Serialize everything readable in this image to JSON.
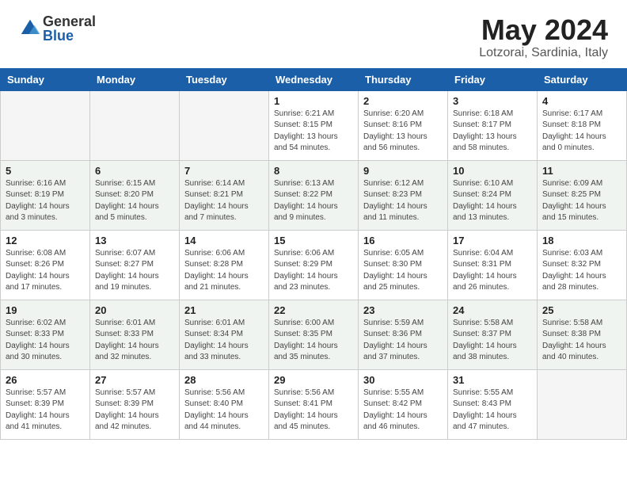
{
  "header": {
    "logo_general": "General",
    "logo_blue": "Blue",
    "month_title": "May 2024",
    "location": "Lotzorai, Sardinia, Italy"
  },
  "weekdays": [
    "Sunday",
    "Monday",
    "Tuesday",
    "Wednesday",
    "Thursday",
    "Friday",
    "Saturday"
  ],
  "weeks": [
    [
      {
        "day": "",
        "info": ""
      },
      {
        "day": "",
        "info": ""
      },
      {
        "day": "",
        "info": ""
      },
      {
        "day": "1",
        "info": "Sunrise: 6:21 AM\nSunset: 8:15 PM\nDaylight: 13 hours\nand 54 minutes."
      },
      {
        "day": "2",
        "info": "Sunrise: 6:20 AM\nSunset: 8:16 PM\nDaylight: 13 hours\nand 56 minutes."
      },
      {
        "day": "3",
        "info": "Sunrise: 6:18 AM\nSunset: 8:17 PM\nDaylight: 13 hours\nand 58 minutes."
      },
      {
        "day": "4",
        "info": "Sunrise: 6:17 AM\nSunset: 8:18 PM\nDaylight: 14 hours\nand 0 minutes."
      }
    ],
    [
      {
        "day": "5",
        "info": "Sunrise: 6:16 AM\nSunset: 8:19 PM\nDaylight: 14 hours\nand 3 minutes."
      },
      {
        "day": "6",
        "info": "Sunrise: 6:15 AM\nSunset: 8:20 PM\nDaylight: 14 hours\nand 5 minutes."
      },
      {
        "day": "7",
        "info": "Sunrise: 6:14 AM\nSunset: 8:21 PM\nDaylight: 14 hours\nand 7 minutes."
      },
      {
        "day": "8",
        "info": "Sunrise: 6:13 AM\nSunset: 8:22 PM\nDaylight: 14 hours\nand 9 minutes."
      },
      {
        "day": "9",
        "info": "Sunrise: 6:12 AM\nSunset: 8:23 PM\nDaylight: 14 hours\nand 11 minutes."
      },
      {
        "day": "10",
        "info": "Sunrise: 6:10 AM\nSunset: 8:24 PM\nDaylight: 14 hours\nand 13 minutes."
      },
      {
        "day": "11",
        "info": "Sunrise: 6:09 AM\nSunset: 8:25 PM\nDaylight: 14 hours\nand 15 minutes."
      }
    ],
    [
      {
        "day": "12",
        "info": "Sunrise: 6:08 AM\nSunset: 8:26 PM\nDaylight: 14 hours\nand 17 minutes."
      },
      {
        "day": "13",
        "info": "Sunrise: 6:07 AM\nSunset: 8:27 PM\nDaylight: 14 hours\nand 19 minutes."
      },
      {
        "day": "14",
        "info": "Sunrise: 6:06 AM\nSunset: 8:28 PM\nDaylight: 14 hours\nand 21 minutes."
      },
      {
        "day": "15",
        "info": "Sunrise: 6:06 AM\nSunset: 8:29 PM\nDaylight: 14 hours\nand 23 minutes."
      },
      {
        "day": "16",
        "info": "Sunrise: 6:05 AM\nSunset: 8:30 PM\nDaylight: 14 hours\nand 25 minutes."
      },
      {
        "day": "17",
        "info": "Sunrise: 6:04 AM\nSunset: 8:31 PM\nDaylight: 14 hours\nand 26 minutes."
      },
      {
        "day": "18",
        "info": "Sunrise: 6:03 AM\nSunset: 8:32 PM\nDaylight: 14 hours\nand 28 minutes."
      }
    ],
    [
      {
        "day": "19",
        "info": "Sunrise: 6:02 AM\nSunset: 8:33 PM\nDaylight: 14 hours\nand 30 minutes."
      },
      {
        "day": "20",
        "info": "Sunrise: 6:01 AM\nSunset: 8:33 PM\nDaylight: 14 hours\nand 32 minutes."
      },
      {
        "day": "21",
        "info": "Sunrise: 6:01 AM\nSunset: 8:34 PM\nDaylight: 14 hours\nand 33 minutes."
      },
      {
        "day": "22",
        "info": "Sunrise: 6:00 AM\nSunset: 8:35 PM\nDaylight: 14 hours\nand 35 minutes."
      },
      {
        "day": "23",
        "info": "Sunrise: 5:59 AM\nSunset: 8:36 PM\nDaylight: 14 hours\nand 37 minutes."
      },
      {
        "day": "24",
        "info": "Sunrise: 5:58 AM\nSunset: 8:37 PM\nDaylight: 14 hours\nand 38 minutes."
      },
      {
        "day": "25",
        "info": "Sunrise: 5:58 AM\nSunset: 8:38 PM\nDaylight: 14 hours\nand 40 minutes."
      }
    ],
    [
      {
        "day": "26",
        "info": "Sunrise: 5:57 AM\nSunset: 8:39 PM\nDaylight: 14 hours\nand 41 minutes."
      },
      {
        "day": "27",
        "info": "Sunrise: 5:57 AM\nSunset: 8:39 PM\nDaylight: 14 hours\nand 42 minutes."
      },
      {
        "day": "28",
        "info": "Sunrise: 5:56 AM\nSunset: 8:40 PM\nDaylight: 14 hours\nand 44 minutes."
      },
      {
        "day": "29",
        "info": "Sunrise: 5:56 AM\nSunset: 8:41 PM\nDaylight: 14 hours\nand 45 minutes."
      },
      {
        "day": "30",
        "info": "Sunrise: 5:55 AM\nSunset: 8:42 PM\nDaylight: 14 hours\nand 46 minutes."
      },
      {
        "day": "31",
        "info": "Sunrise: 5:55 AM\nSunset: 8:43 PM\nDaylight: 14 hours\nand 47 minutes."
      },
      {
        "day": "",
        "info": ""
      }
    ]
  ]
}
